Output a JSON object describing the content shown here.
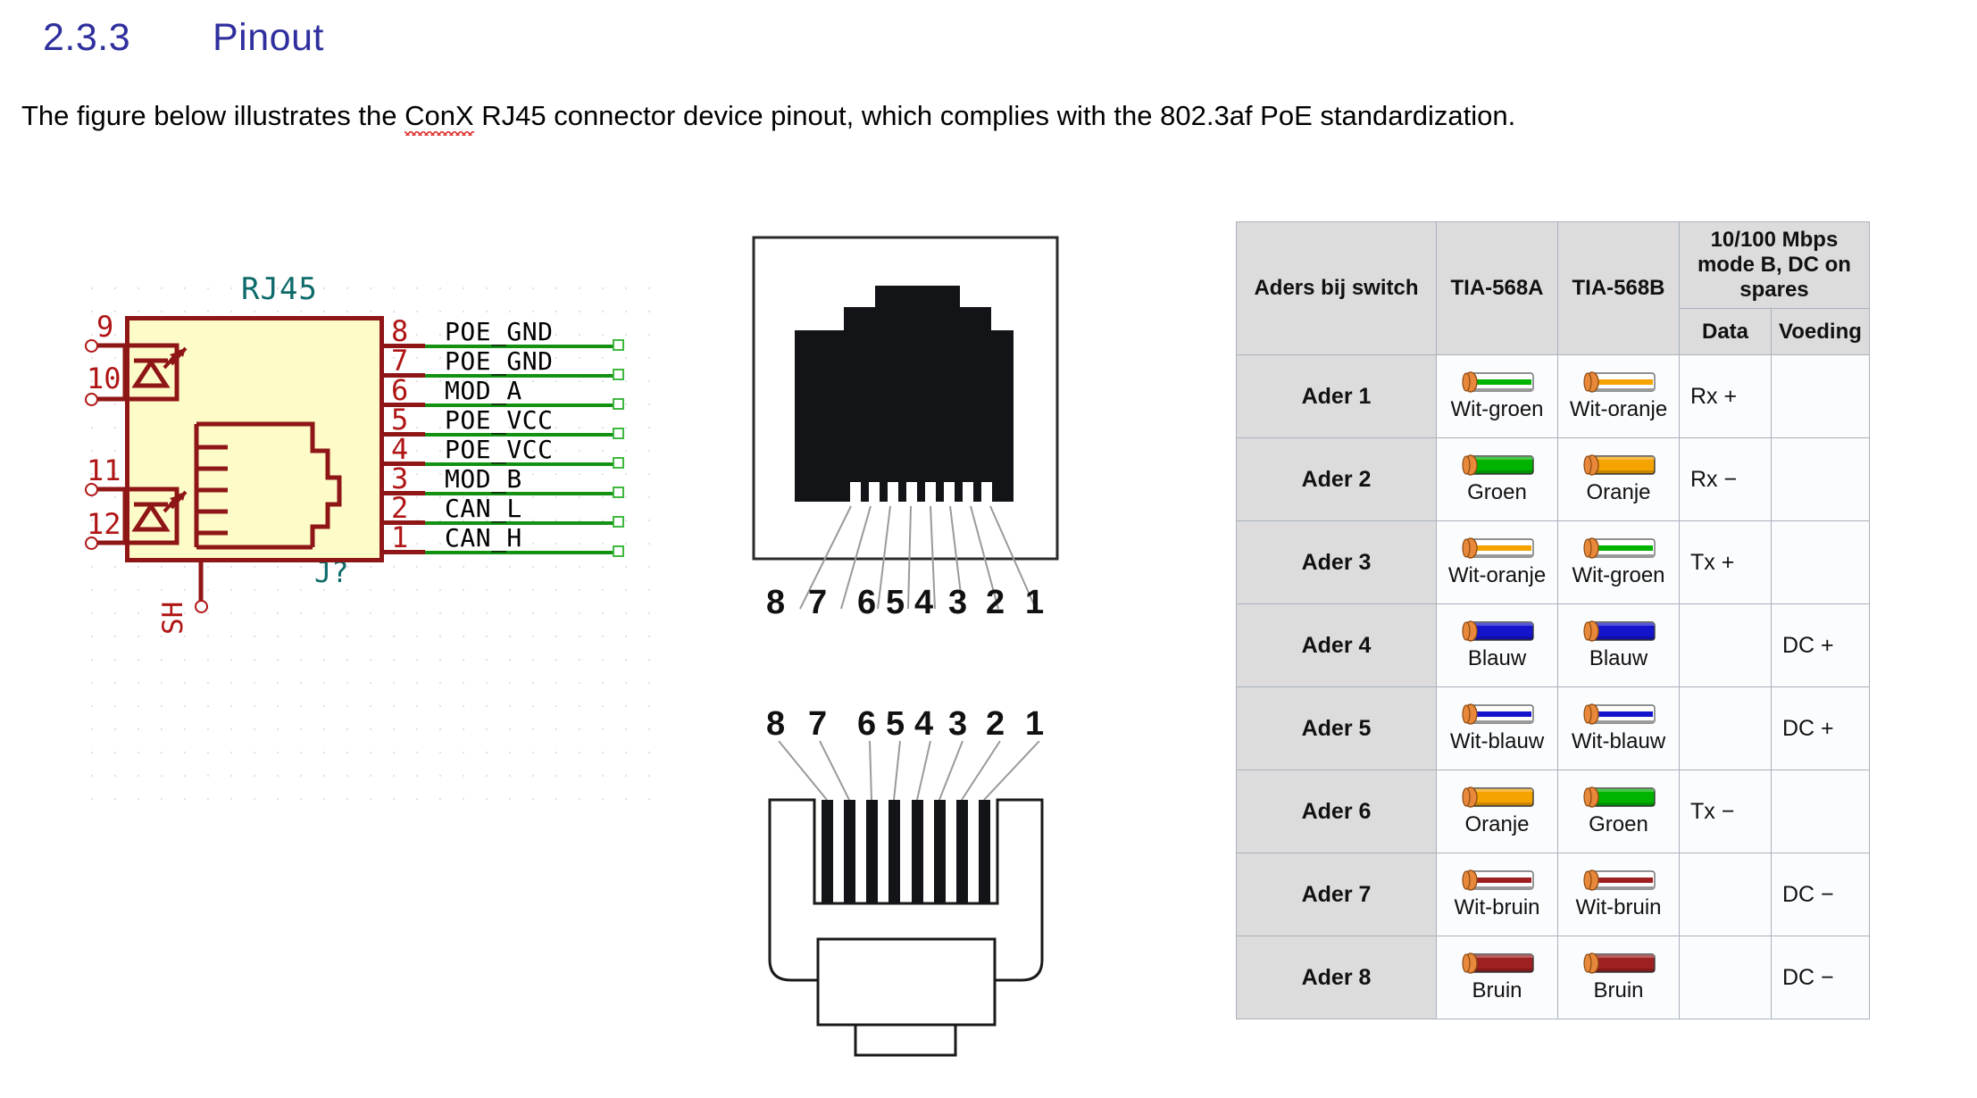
{
  "heading": {
    "number": "2.3.3",
    "title": "Pinout"
  },
  "intro": {
    "before": "The figure below illustrates the ",
    "misspelled": "ConX",
    "after": " RJ45 connector device pinout, which complies with the 802.3af PoE standardization."
  },
  "schematic": {
    "title": "RJ45",
    "refdes": "J?",
    "shield_label": "SH",
    "right_pins": [
      {
        "num": "8",
        "label": "POE_GND"
      },
      {
        "num": "7",
        "label": "POE_GND"
      },
      {
        "num": "6",
        "label": "MOD_A"
      },
      {
        "num": "5",
        "label": "POE_VCC"
      },
      {
        "num": "4",
        "label": "POE_VCC"
      },
      {
        "num": "3",
        "label": "MOD_B"
      },
      {
        "num": "2",
        "label": "CAN_L"
      },
      {
        "num": "1",
        "label": "CAN_H"
      }
    ],
    "left_pins": [
      {
        "num": "9"
      },
      {
        "num": "10"
      },
      {
        "num": "11"
      },
      {
        "num": "12"
      }
    ],
    "colors": {
      "outline": "#8f1616",
      "fill": "#fdfbc8",
      "pin_number": "#b01515",
      "wire_green": "#129112",
      "title_text": "#0f6b6b"
    }
  },
  "jack_figure": {
    "name": "rj45-jack-front-view",
    "pin_numbers": [
      "8",
      "7",
      "6",
      "5",
      "4",
      "3",
      "2",
      "1"
    ]
  },
  "plug_figure": {
    "name": "rj45-plug-front-view",
    "pin_numbers": [
      "8",
      "7",
      "6",
      "5",
      "4",
      "3",
      "2",
      "1"
    ]
  },
  "table": {
    "headers": {
      "col1": "Aders bij switch",
      "col2": "TIA-568A",
      "col3": "TIA-568B",
      "group": "10/100 Mbps mode B, DC on spares",
      "sub_data": "Data",
      "sub_power": "Voeding"
    },
    "rows": [
      {
        "ader": "Ader 1",
        "a_wire": "wit-groen",
        "a_name": "Wit-groen",
        "b_wire": "wit-oranje",
        "b_name": "Wit-oranje",
        "data": "Rx +",
        "voeding": ""
      },
      {
        "ader": "Ader 2",
        "a_wire": "groen",
        "a_name": "Groen",
        "b_wire": "oranje",
        "b_name": "Oranje",
        "data": "Rx −",
        "voeding": ""
      },
      {
        "ader": "Ader 3",
        "a_wire": "wit-oranje",
        "a_name": "Wit-oranje",
        "b_wire": "wit-groen",
        "b_name": "Wit-groen",
        "data": "Tx +",
        "voeding": ""
      },
      {
        "ader": "Ader 4",
        "a_wire": "blauw",
        "a_name": "Blauw",
        "b_wire": "blauw",
        "b_name": "Blauw",
        "data": "",
        "voeding": "DC +"
      },
      {
        "ader": "Ader 5",
        "a_wire": "wit-blauw",
        "a_name": "Wit-blauw",
        "b_wire": "wit-blauw",
        "b_name": "Wit-blauw",
        "data": "",
        "voeding": "DC +"
      },
      {
        "ader": "Ader 6",
        "a_wire": "oranje",
        "a_name": "Oranje",
        "b_wire": "groen",
        "b_name": "Groen",
        "data": "Tx −",
        "voeding": ""
      },
      {
        "ader": "Ader 7",
        "a_wire": "wit-bruin",
        "a_name": "Wit-bruin",
        "b_wire": "wit-bruin",
        "b_name": "Wit-bruin",
        "data": "",
        "voeding": "DC −"
      },
      {
        "ader": "Ader 8",
        "a_wire": "bruin",
        "a_name": "Bruin",
        "b_wire": "bruin",
        "b_name": "Bruin",
        "data": "",
        "voeding": "DC −"
      }
    ],
    "wire_colors": {
      "groen": "#00b300",
      "oranje": "#f5a300",
      "blauw": "#1414cc",
      "bruin": "#9e2020",
      "white": "#ffffff",
      "copper": "#e8883a"
    },
    "colors": {
      "header_bg": "#dcdcdc",
      "cell_bg": "#fbfcfe",
      "border": "#a9b2bd"
    }
  }
}
